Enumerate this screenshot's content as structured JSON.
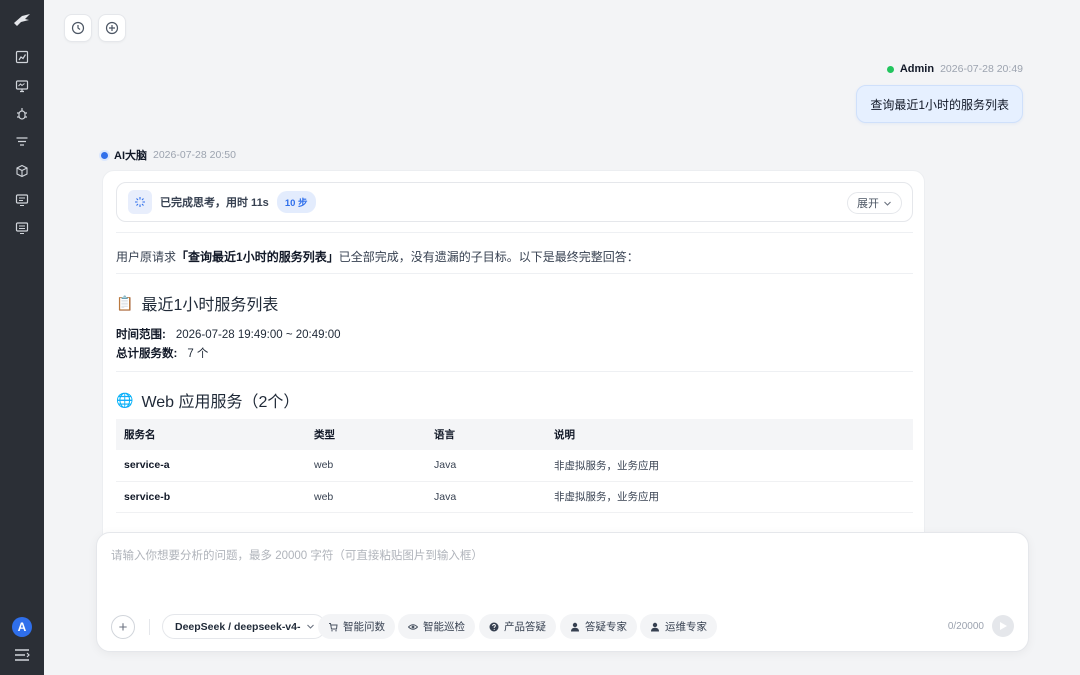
{
  "sidebar": {
    "icons": [
      "logo-icon",
      "chart-icon",
      "monitor-icon",
      "bug-icon",
      "filter-icon",
      "cube-icon",
      "message-icon",
      "chat-icon"
    ],
    "avatar_letter": "A"
  },
  "user_message": {
    "name": "Admin",
    "time": "2026-07-28 20:49",
    "text": "查询最近1小时的服务列表"
  },
  "ai_message": {
    "name": "AI大脑",
    "time": "2026-07-28 20:50",
    "thinking": {
      "status": "已完成思考，用时 11s",
      "steps": "10 步",
      "expand_label": "展开"
    },
    "intro_prefix": "用户原请求",
    "intro_quote": "「查询最近1小时的服务列表」",
    "intro_suffix": "已全部完成，没有遗漏的子目标。以下是最终完整回答：",
    "section1_title": "最近1小时服务列表",
    "time_range_label": "时间范围:",
    "time_range_value": "2026-07-28 19:49:00 ~ 20:49:00",
    "total_label": "总计服务数:",
    "total_value": "7 个",
    "section2_title": "Web 应用服务（2个）",
    "table": {
      "headers": [
        "服务名",
        "类型",
        "语言",
        "说明"
      ],
      "rows": [
        [
          "service-a",
          "web",
          "Java",
          "非虚拟服务，业务应用"
        ],
        [
          "service-b",
          "web",
          "Java",
          "非虚拟服务，业务应用"
        ]
      ]
    }
  },
  "composer": {
    "placeholder": "请输入你想要分析的问题，最多 20000 字符（可直接粘贴图片到输入框）",
    "model": "DeepSeek / deepseek-v4-",
    "chips": [
      "智能问数",
      "智能巡检",
      "产品答疑",
      "答疑专家",
      "运维专家"
    ],
    "counter": "0/20000"
  },
  "colors": {
    "accent": "#2f6feb",
    "online": "#22c55e",
    "sidebar_bg": "#2b2f36"
  }
}
